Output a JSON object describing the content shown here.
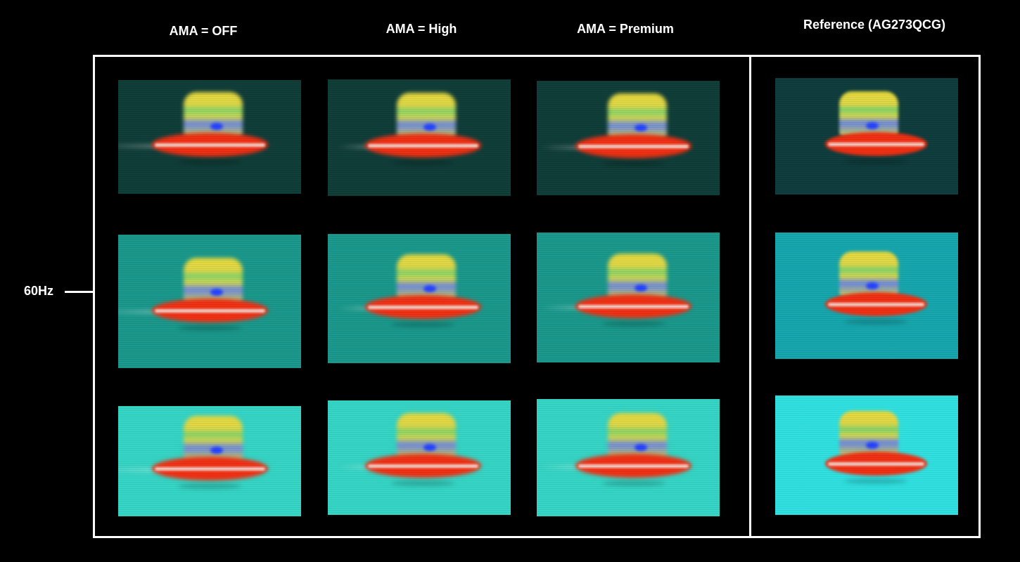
{
  "columns": [
    {
      "label": "AMA = OFF"
    },
    {
      "label": "AMA = High"
    },
    {
      "label": "AMA = Premium"
    },
    {
      "label": "Reference (AG273QCG)"
    }
  ],
  "row_label": "60Hz",
  "rows": [
    {
      "background": "#0d3b36",
      "name": "dark"
    },
    {
      "background": "#17978a",
      "name": "medium"
    },
    {
      "background": "#33d4c4",
      "name": "light"
    }
  ],
  "reference_backgrounds": [
    "#0c3a3a",
    "#14a5ac",
    "#2ee0e0"
  ],
  "panels": [
    [
      {
        "content": "blurred UFO, long trail",
        "blur_level": "high"
      },
      {
        "content": "blurred UFO, medium trail",
        "blur_level": "medium"
      },
      {
        "content": "blurred UFO, overshoot trail",
        "blur_level": "medium"
      },
      {
        "content": "reference UFO",
        "blur_level": "low"
      }
    ],
    [
      {
        "content": "blurred UFO, long trail",
        "blur_level": "high"
      },
      {
        "content": "blurred UFO, medium trail",
        "blur_level": "medium"
      },
      {
        "content": "blurred UFO, overshoot trail",
        "blur_level": "medium"
      },
      {
        "content": "reference UFO",
        "blur_level": "low"
      }
    ],
    [
      {
        "content": "blurred UFO, long trail",
        "blur_level": "high"
      },
      {
        "content": "blurred UFO, medium trail",
        "blur_level": "medium"
      },
      {
        "content": "blurred UFO, overshoot trail",
        "blur_level": "medium"
      },
      {
        "content": "reference UFO",
        "blur_level": "low"
      }
    ]
  ]
}
